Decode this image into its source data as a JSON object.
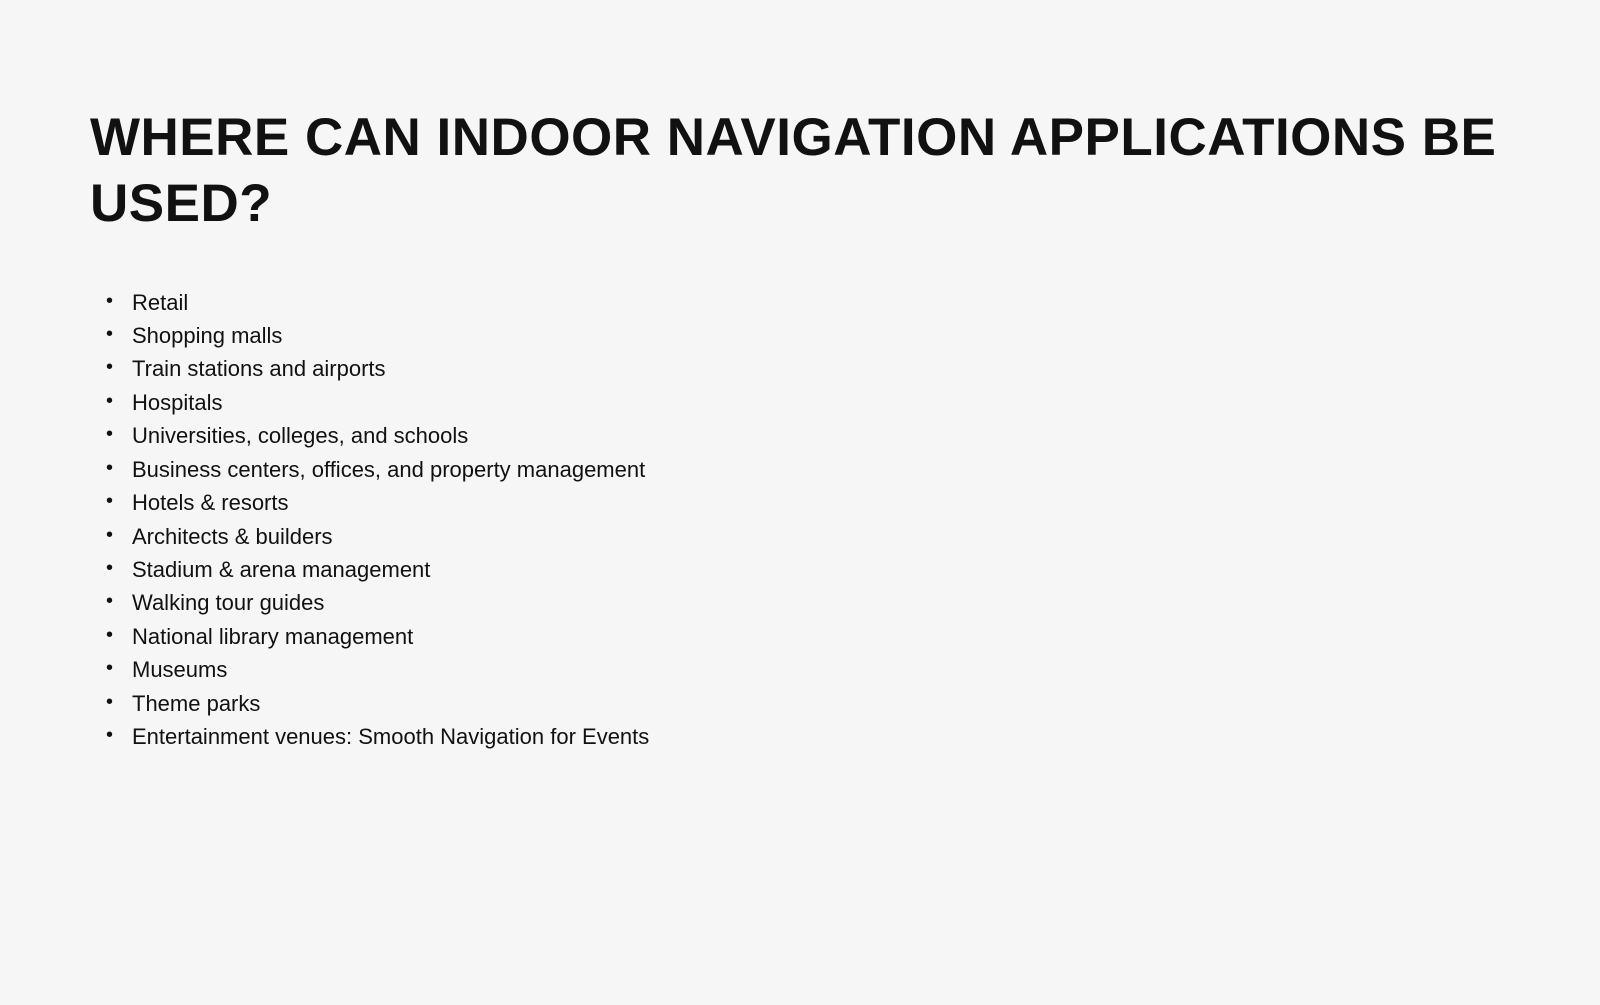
{
  "heading": "WHERE CAN INDOOR NAVIGATION APPLICATIONS BE USED?",
  "items": [
    "Retail",
    "Shopping malls",
    "Train stations and airports",
    "Hospitals",
    "Universities, colleges, and schools",
    "Business centers, offices, and property management",
    "Hotels & resorts",
    "Architects & builders",
    "Stadium & arena management",
    "Walking tour guides",
    "National library management",
    "Museums",
    "Theme parks",
    "Entertainment venues: Smooth Navigation for Events"
  ]
}
